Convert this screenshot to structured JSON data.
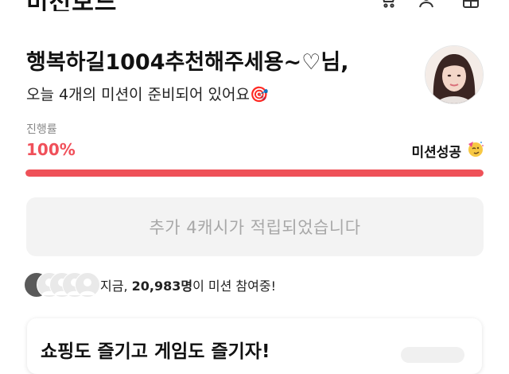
{
  "header": {
    "title": "미션보드",
    "icons": [
      "cart-icon",
      "add-user-icon",
      "gift-icon"
    ]
  },
  "greeting": {
    "name": "행복하길1004추천해주세용~♡님,",
    "subtitle": "오늘 4개의 미션이 준비되어 있어요🎯"
  },
  "progress": {
    "label": "진행률",
    "value_text": "100%",
    "fraction": 1.0,
    "status": "미션성공",
    "status_icon": "party-face-icon"
  },
  "reward": {
    "label": "추가 4캐시가 적립되었습니다"
  },
  "participants": {
    "prefix": "지금, ",
    "count": "20,983명",
    "suffix": "이 미션 참여중!"
  },
  "promo": {
    "title": "쇼핑도 즐기고 게임도 즐기자!"
  },
  "colors": {
    "accent": "#ef5158",
    "progress_text": "#f0505a",
    "reward_bg": "#f3f3f3",
    "reward_text": "#a8a8a8"
  }
}
